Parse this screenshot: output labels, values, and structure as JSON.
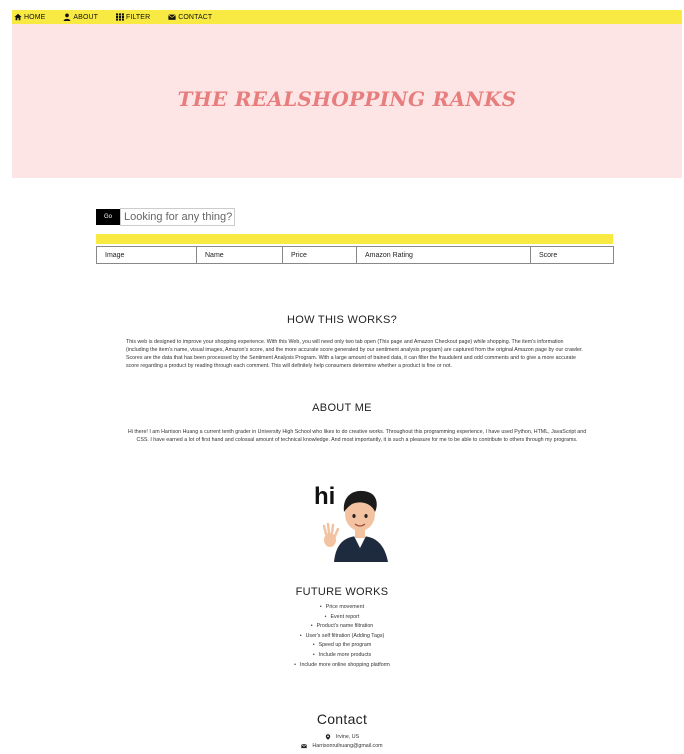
{
  "nav": {
    "items": [
      {
        "label": "HOME",
        "icon": "home-icon"
      },
      {
        "label": "ABOUT",
        "icon": "user-icon"
      },
      {
        "label": "FILTER",
        "icon": "grid-icon"
      },
      {
        "label": "CONTACT",
        "icon": "envelope-icon"
      }
    ],
    "bar_color": "#f8ea43"
  },
  "hero": {
    "title": "THE REALSHOPPING RANKS",
    "background": "#fde5e5",
    "title_color": "#e87d7d"
  },
  "search": {
    "button_label": "Go",
    "placeholder": "Looking for any thing?"
  },
  "table": {
    "columns": [
      "Image",
      "Name",
      "Price",
      "Amazon Rating",
      "Score"
    ]
  },
  "how": {
    "title": "HOW THIS WORKS?",
    "text": "This web is designed to improve your shopping experience. With this Web, you will need only two tab open (This page and Amazon Checkout page) while shopping. The item's information (including the item's name, visual images, Amazon's score, and the more accurate score generated by our sentiment analysis program) are captured from the original Amazon page by our crawler. Scores are the data that has been processed by the Sentiment Analysis Program. With a large amount of trained data, it can filter the fraudulent and odd comments and to give a more accurate score regarding a product by reading through each comment. This will definitely help consumers determine whether a product is fine or not."
  },
  "about": {
    "title": "ABOUT ME",
    "text": "Hi there! I am Harrison Huang a current tenth grader in University High School who likes to do creative works. Throughout this programming experience, I have used Python, HTML, JavaScript and CSS. I have earned a lot of first hand and colossal amount of technical knowledge. And most importantly, it is such a pleasure for me to be able to contribute to others through my programs.",
    "avatar_text": "hi"
  },
  "future": {
    "title": "FUTURE WORKS",
    "items": [
      "Price movement",
      "Event report",
      "Product's name filtration",
      "User's self filtration (Adding Tags)",
      "Speed up the program",
      "Include more products",
      "Include more online shopping platform"
    ]
  },
  "contact": {
    "title": "Contact",
    "location": "Irvine, US",
    "email": "Harrisonruihuang@gmail.com"
  }
}
